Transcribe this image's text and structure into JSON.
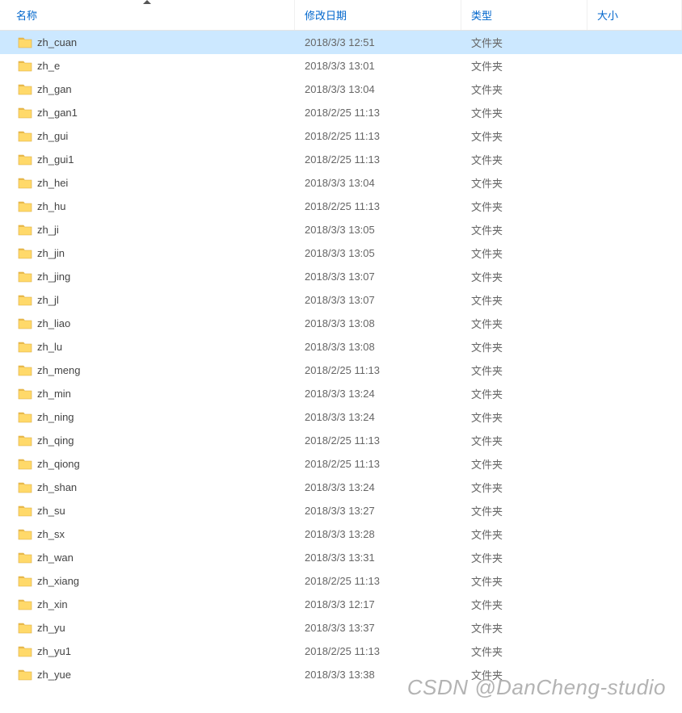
{
  "columns": {
    "name": "名称",
    "date": "修改日期",
    "type": "类型",
    "size": "大小"
  },
  "type_folder": "文件夹",
  "watermark": "CSDN @DanCheng-studio",
  "items": [
    {
      "name": "zh_cuan",
      "date": "2018/3/3 12:51",
      "type": "文件夹",
      "selected": true
    },
    {
      "name": "zh_e",
      "date": "2018/3/3 13:01",
      "type": "文件夹",
      "selected": false
    },
    {
      "name": "zh_gan",
      "date": "2018/3/3 13:04",
      "type": "文件夹",
      "selected": false
    },
    {
      "name": "zh_gan1",
      "date": "2018/2/25 11:13",
      "type": "文件夹",
      "selected": false
    },
    {
      "name": "zh_gui",
      "date": "2018/2/25 11:13",
      "type": "文件夹",
      "selected": false
    },
    {
      "name": "zh_gui1",
      "date": "2018/2/25 11:13",
      "type": "文件夹",
      "selected": false
    },
    {
      "name": "zh_hei",
      "date": "2018/3/3 13:04",
      "type": "文件夹",
      "selected": false
    },
    {
      "name": "zh_hu",
      "date": "2018/2/25 11:13",
      "type": "文件夹",
      "selected": false
    },
    {
      "name": "zh_ji",
      "date": "2018/3/3 13:05",
      "type": "文件夹",
      "selected": false
    },
    {
      "name": "zh_jin",
      "date": "2018/3/3 13:05",
      "type": "文件夹",
      "selected": false
    },
    {
      "name": "zh_jing",
      "date": "2018/3/3 13:07",
      "type": "文件夹",
      "selected": false
    },
    {
      "name": "zh_jl",
      "date": "2018/3/3 13:07",
      "type": "文件夹",
      "selected": false
    },
    {
      "name": "zh_liao",
      "date": "2018/3/3 13:08",
      "type": "文件夹",
      "selected": false
    },
    {
      "name": "zh_lu",
      "date": "2018/3/3 13:08",
      "type": "文件夹",
      "selected": false
    },
    {
      "name": "zh_meng",
      "date": "2018/2/25 11:13",
      "type": "文件夹",
      "selected": false
    },
    {
      "name": "zh_min",
      "date": "2018/3/3 13:24",
      "type": "文件夹",
      "selected": false
    },
    {
      "name": "zh_ning",
      "date": "2018/3/3 13:24",
      "type": "文件夹",
      "selected": false
    },
    {
      "name": "zh_qing",
      "date": "2018/2/25 11:13",
      "type": "文件夹",
      "selected": false
    },
    {
      "name": "zh_qiong",
      "date": "2018/2/25 11:13",
      "type": "文件夹",
      "selected": false
    },
    {
      "name": "zh_shan",
      "date": "2018/3/3 13:24",
      "type": "文件夹",
      "selected": false
    },
    {
      "name": "zh_su",
      "date": "2018/3/3 13:27",
      "type": "文件夹",
      "selected": false
    },
    {
      "name": "zh_sx",
      "date": "2018/3/3 13:28",
      "type": "文件夹",
      "selected": false
    },
    {
      "name": "zh_wan",
      "date": "2018/3/3 13:31",
      "type": "文件夹",
      "selected": false
    },
    {
      "name": "zh_xiang",
      "date": "2018/2/25 11:13",
      "type": "文件夹",
      "selected": false
    },
    {
      "name": "zh_xin",
      "date": "2018/3/3 12:17",
      "type": "文件夹",
      "selected": false
    },
    {
      "name": "zh_yu",
      "date": "2018/3/3 13:37",
      "type": "文件夹",
      "selected": false
    },
    {
      "name": "zh_yu1",
      "date": "2018/2/25 11:13",
      "type": "文件夹",
      "selected": false
    },
    {
      "name": "zh_yue",
      "date": "2018/3/3 13:38",
      "type": "文件夹",
      "selected": false
    }
  ]
}
